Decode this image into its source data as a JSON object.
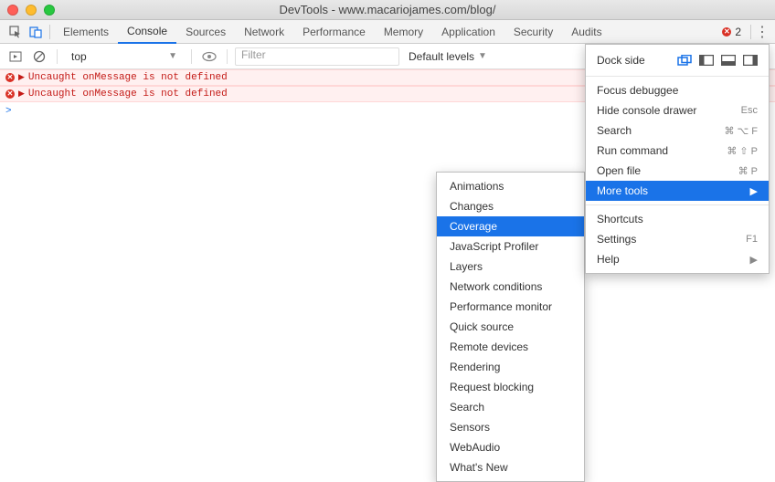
{
  "window": {
    "title": "DevTools - www.macariojames.com/blog/"
  },
  "tabs": {
    "items": [
      "Elements",
      "Console",
      "Sources",
      "Network",
      "Performance",
      "Memory",
      "Application",
      "Security",
      "Audits"
    ],
    "active": "Console",
    "error_count": "2"
  },
  "console_toolbar": {
    "context": "top",
    "filter_placeholder": "Filter",
    "levels": "Default levels"
  },
  "console": {
    "errors": [
      "Uncaught onMessage is not defined",
      "Uncaught onMessage is not defined"
    ],
    "prompt": ">"
  },
  "menu": {
    "dock_label": "Dock side",
    "group1": [
      {
        "label": "Focus debuggee",
        "shortcut": ""
      },
      {
        "label": "Hide console drawer",
        "shortcut": "Esc"
      },
      {
        "label": "Search",
        "shortcut": "⌘ ⌥ F"
      },
      {
        "label": "Run command",
        "shortcut": "⌘ ⇧ P"
      },
      {
        "label": "Open file",
        "shortcut": "⌘ P"
      },
      {
        "label": "More tools",
        "shortcut": "▶",
        "highlight": true
      }
    ],
    "group2": [
      {
        "label": "Shortcuts",
        "shortcut": ""
      },
      {
        "label": "Settings",
        "shortcut": "F1"
      },
      {
        "label": "Help",
        "shortcut": "▶"
      }
    ]
  },
  "submenu": {
    "items": [
      "Animations",
      "Changes",
      "Coverage",
      "JavaScript Profiler",
      "Layers",
      "Network conditions",
      "Performance monitor",
      "Quick source",
      "Remote devices",
      "Rendering",
      "Request blocking",
      "Search",
      "Sensors",
      "WebAudio",
      "What's New"
    ],
    "highlight": "Coverage"
  }
}
